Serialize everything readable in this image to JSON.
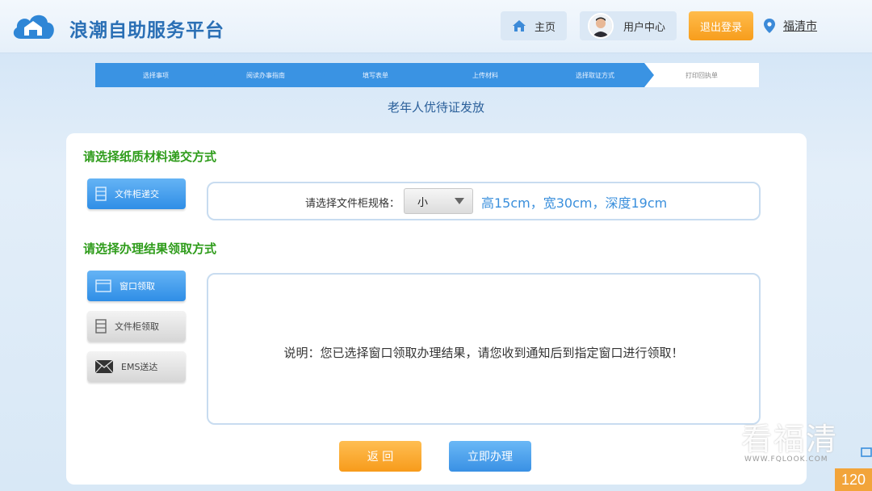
{
  "header": {
    "title": "浪潮自助服务平台",
    "home_label": "主页",
    "user_center_label": "用户中心",
    "logout_label": "退出登录",
    "city": "福清市"
  },
  "steps": [
    {
      "label": "选择事项",
      "active": true
    },
    {
      "label": "阅读办事指南",
      "active": true
    },
    {
      "label": "填写表单",
      "active": true
    },
    {
      "label": "上传材料",
      "active": true
    },
    {
      "label": "选择取证方式",
      "active": true
    },
    {
      "label": "打印回执单",
      "active": false
    }
  ],
  "page_subtitle": "老年人优待证发放",
  "paper_section": {
    "title": "请选择纸质材料递交方式",
    "option_label": "文件柜递交",
    "cabinet_prompt": "请选择文件柜规格：",
    "cabinet_selected": "小",
    "cabinet_size": "高15cm，宽30cm，深度19cm"
  },
  "result_section": {
    "title": "请选择办理结果领取方式",
    "options": [
      {
        "label": "窗口领取",
        "selected": true
      },
      {
        "label": "文件柜领取",
        "selected": false
      },
      {
        "label": "EMS送达",
        "selected": false
      }
    ],
    "description": "说明：您已选择窗口领取办理结果，请您收到通知后到指定窗口进行领取！"
  },
  "actions": {
    "back_label": "返 回",
    "submit_label": "立即办理"
  },
  "watermark": {
    "brand": "看福清",
    "url": "WWW.FQLOOK.COM"
  },
  "counter": "120",
  "colors": {
    "brand_blue": "#2a6fb5",
    "section_green": "#2f9c1b",
    "accent_orange": "#f79d1c",
    "button_blue": "#2f8ee6"
  }
}
